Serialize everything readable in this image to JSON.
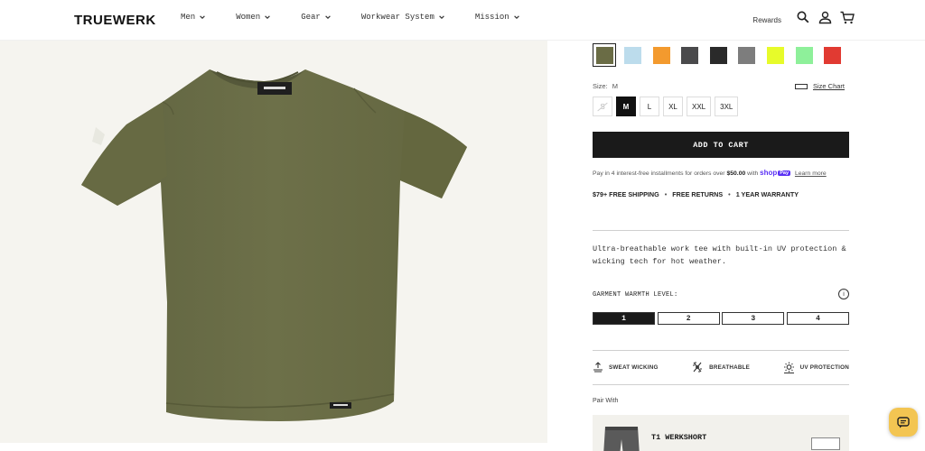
{
  "header": {
    "logo": "TRUEWERK",
    "nav": [
      {
        "label": "Men"
      },
      {
        "label": "Women"
      },
      {
        "label": "Gear"
      },
      {
        "label": "Workwear System"
      },
      {
        "label": "Mission"
      }
    ],
    "rewards_label": "Rewards",
    "icons": [
      "search-icon",
      "account-icon",
      "cart-icon"
    ]
  },
  "product": {
    "image_alt_color": "#6b6e47",
    "swatches": [
      {
        "color": "#6a6c45",
        "selected": true
      },
      {
        "color": "#bcdcec",
        "selected": false
      },
      {
        "color": "#f39a2e",
        "selected": false
      },
      {
        "color": "#4a4a4c",
        "selected": false
      },
      {
        "color": "#2a2a2a",
        "selected": false
      },
      {
        "color": "#7d7d7d",
        "selected": false
      },
      {
        "color": "#e7fb2a",
        "selected": false
      },
      {
        "color": "#8ef09a",
        "selected": false
      },
      {
        "color": "#e13a32",
        "selected": false
      }
    ],
    "size_label": "Size:",
    "size_value": "M",
    "size_chart_label": "Size Chart",
    "sizes": [
      {
        "label": "S",
        "state": "unavailable"
      },
      {
        "label": "M",
        "state": "selected"
      },
      {
        "label": "L",
        "state": "available"
      },
      {
        "label": "XL",
        "state": "available"
      },
      {
        "label": "XXL",
        "state": "available"
      },
      {
        "label": "3XL",
        "state": "available"
      }
    ],
    "add_to_cart": "ADD TO CART",
    "installments": {
      "text": "Pay in 4 interest-free installments for orders over",
      "amount": "$50.00",
      "with": "with",
      "shop": "shop",
      "pay": "Pay",
      "learn_more": "Learn more"
    },
    "perks": [
      "$79+ FREE SHIPPING",
      "FREE RETURNS",
      "1 YEAR WARRANTY"
    ],
    "description": "Ultra-breathable work tee with built-in UV protection & wicking tech for hot weather.",
    "warmth": {
      "label": "GARMENT WARMTH LEVEL:",
      "levels": [
        "1",
        "2",
        "3",
        "4"
      ],
      "selected_level": 1
    },
    "features": [
      {
        "label": "SWEAT WICKING",
        "icon": "sweat-wicking-icon"
      },
      {
        "label": "BREATHABLE",
        "icon": "breathable-icon"
      },
      {
        "label": "UV PROTECTION",
        "icon": "uv-protection-icon"
      }
    ],
    "pair_with": {
      "label": "Pair With",
      "item_name": "T1 WERKSHORT"
    }
  },
  "chat_icon": "chat-icon"
}
